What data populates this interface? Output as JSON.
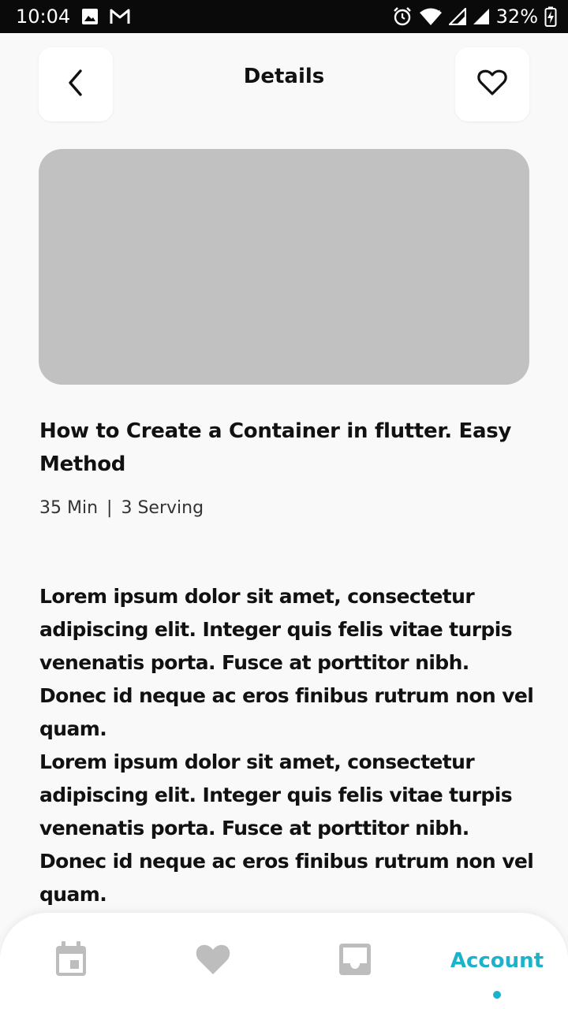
{
  "status_bar": {
    "time": "10:04",
    "battery": "32%",
    "left_icons": [
      "image-icon",
      "gmail-icon"
    ],
    "right_icons": [
      "alarm-icon",
      "wifi-icon",
      "signal-icon",
      "signal-icon",
      "battery-charging-icon"
    ]
  },
  "header": {
    "title": "Details",
    "back_icon": "chevron-left-icon",
    "favorite_icon": "heart-outline-icon"
  },
  "recipe": {
    "title": "How to Create a Container in flutter. Easy Method",
    "duration": "35 Min",
    "separator": "|",
    "servings": "3 Serving",
    "description": [
      "Lorem ipsum dolor sit amet, consectetur adipiscing elit. Integer quis felis vitae turpis venenatis porta. Fusce at porttitor nibh. Donec id neque ac eros finibus rutrum non vel quam.",
      "Lorem ipsum dolor sit amet, consectetur adipiscing elit. Integer quis felis vitae turpis venenatis porta. Fusce at porttitor nibh. Donec id neque ac eros finibus rutrum non vel quam."
    ]
  },
  "bottom_nav": {
    "items": [
      {
        "icon": "calendar-icon",
        "active": false
      },
      {
        "icon": "heart-icon",
        "active": false
      },
      {
        "icon": "inbox-icon",
        "active": false
      },
      {
        "label": "Account",
        "active": true
      }
    ]
  },
  "colors": {
    "accent": "#1bb3cc",
    "inactive_icon": "#bdbdbd",
    "image_placeholder": "#c1c1c1",
    "background": "#f9f9f9"
  }
}
